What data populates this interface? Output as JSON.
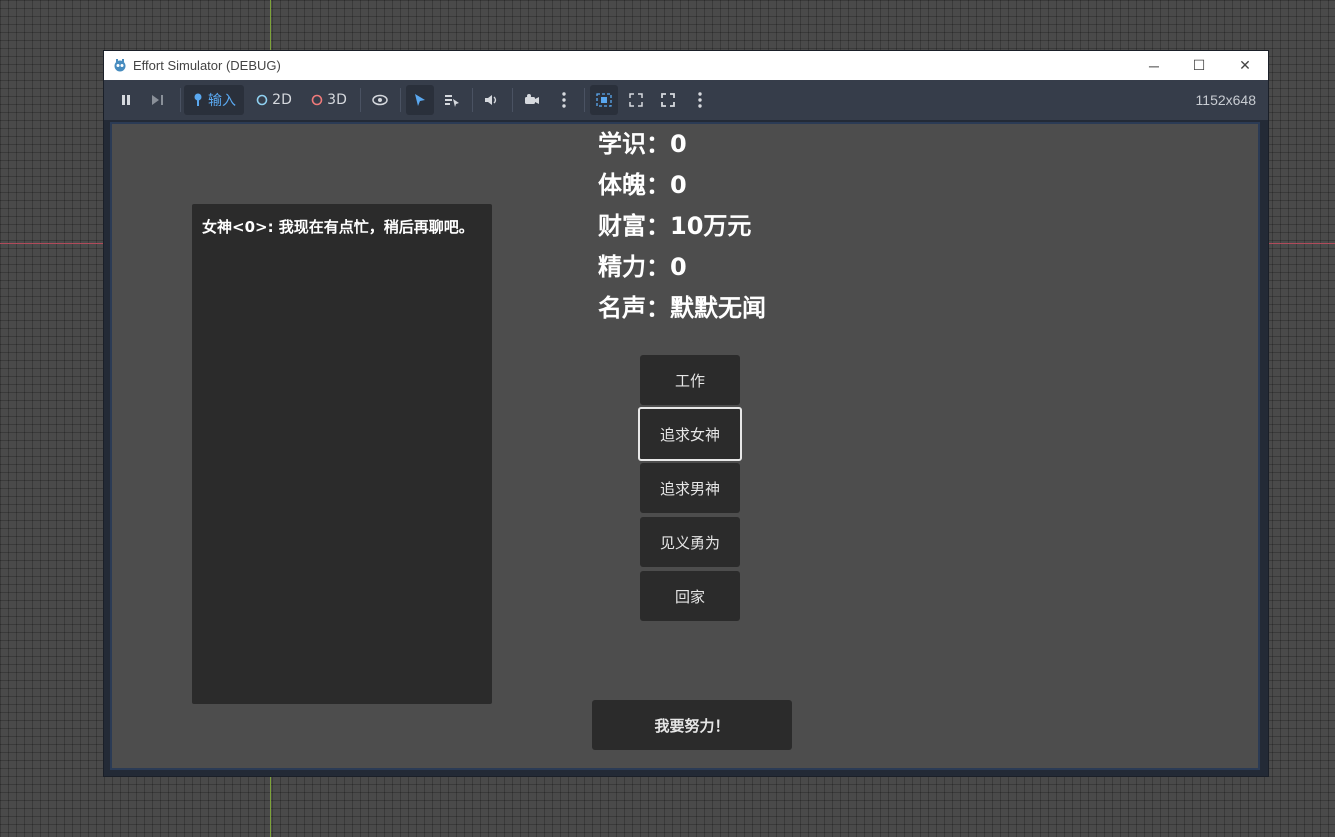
{
  "window": {
    "title": "Effort Simulator (DEBUG)",
    "minimize_icon": "─",
    "maximize_icon": "☐",
    "close_icon": "✕"
  },
  "toolbar": {
    "input_label": "输入",
    "label_2d": "2D",
    "label_3d": "3D",
    "resolution": "1152x648",
    "colors": {
      "accent": "#5aa8f0",
      "mode2d": "#8fd0f0",
      "mode3d": "#f07a7a"
    }
  },
  "game": {
    "dialog": "女神<0>: 我现在有点忙，稍后再聊吧。",
    "stats": [
      {
        "label": "学识：",
        "value": "0"
      },
      {
        "label": "体魄：",
        "value": "0"
      },
      {
        "label": "财富：",
        "value": "10万元"
      },
      {
        "label": "精力：",
        "value": "0"
      },
      {
        "label": "名声：",
        "value": "默默无闻"
      }
    ],
    "actions": [
      {
        "label": "工作"
      },
      {
        "label": "追求女神"
      },
      {
        "label": "追求男神"
      },
      {
        "label": "见义勇为"
      },
      {
        "label": "回家"
      }
    ],
    "effort_button": "我要努力！"
  }
}
